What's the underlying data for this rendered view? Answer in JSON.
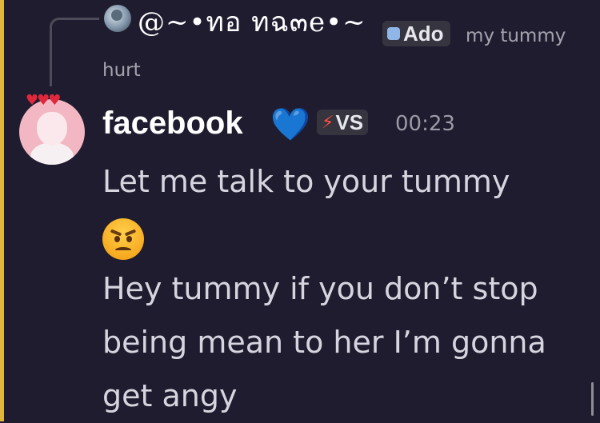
{
  "reply": {
    "author": "@~•ทอ ทฉ๓e•~",
    "tag": "Ado",
    "preview_line1": "my tummy",
    "preview_line2": "hurt"
  },
  "message": {
    "author": "facebook",
    "author_heart": "💙",
    "role_tag": "VS",
    "timestamp": "00:23",
    "line1": "Let me talk to your tummy",
    "line3": "Hey tummy if you don’t stop",
    "line4": "being mean to her I’m gonna",
    "line5": "get angy"
  },
  "icons": {
    "reply_avatar": "user-avatar-icon",
    "tag_icon": "server-badge-icon",
    "role_icon": "lightning-bolt-icon",
    "emoji": "angry-face-emoji",
    "avatar_decoration": "hearts-decoration-icon"
  },
  "colors": {
    "background": "#1f1c2f",
    "accent_bar": "#e0b63c",
    "heart": "#2d7ff0",
    "bolt": "#ff4d3d",
    "text": "#d6d5df"
  }
}
